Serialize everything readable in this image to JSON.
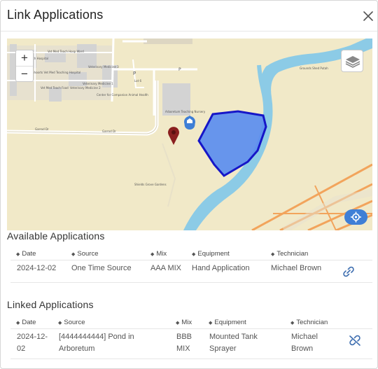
{
  "dialog": {
    "title": "Link Applications"
  },
  "map": {
    "zoom_in": "+",
    "zoom_out": "−",
    "labels": [
      "Vet Med Teach Hosp Ward",
      "Veterinary Medicine 3",
      "Teach Hospital",
      "Shoorts Vet Med Teaching Hospital",
      "Veterinary Medicine 2",
      "Vet Med Teach Food",
      "Veterinary Medicine 1",
      "Center for Companion Animal Health",
      "Lot 6",
      "Arboretum Teaching Nursery",
      "Garrod Dr",
      "Shields Grove Gardens",
      "Grounds Shed Putah"
    ],
    "parking_letter": "P",
    "accent_color": "#5b8def"
  },
  "available": {
    "title": "Available Applications",
    "headers": [
      "Date",
      "Source",
      "Mix",
      "Equipment",
      "Technician"
    ],
    "rows": [
      {
        "date": "2024-12-02",
        "source": "One Time Source",
        "mix": "AAA MIX",
        "equipment": "Hand Application",
        "technician": "Michael Brown",
        "action_icon": "link-icon"
      }
    ]
  },
  "linked": {
    "title": "Linked Applications",
    "headers": [
      "Date",
      "Source",
      "Mix",
      "Equipment",
      "Technician"
    ],
    "rows": [
      {
        "date_line1": "2024-12-",
        "date_line2": "02",
        "source_line1": "[4444444444] Pond in",
        "source_line2": "Arboretum",
        "mix_line1": "BBB",
        "mix_line2": "MIX",
        "equipment_line1": "Mounted Tank",
        "equipment_line2": "Sprayer",
        "technician_line1": "Michael",
        "technician_line2": "Brown",
        "action_icon": "unlink-icon"
      }
    ]
  }
}
